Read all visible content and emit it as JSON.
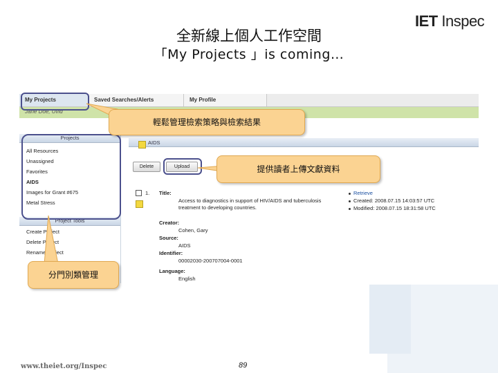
{
  "slide": {
    "title_line1": "全新線上個人工作空間",
    "title_line2": "「My Projects 」is coming…",
    "logo_iet": "IET",
    "logo_inspec": "Inspec",
    "footer_url": "www.theiet.org/Inspec",
    "page_number": "89"
  },
  "tabs": [
    "My Projects",
    "Saved Searches/Alerts",
    "My Profile"
  ],
  "user_name": "Jane Doe, Uvid",
  "projects_panel": {
    "header": "Projects",
    "items": [
      "All Resources",
      "Unassigned",
      "Favorites",
      "AIDS",
      "Images for Grant #675",
      "Metal Stress"
    ],
    "selected": "AIDS"
  },
  "project_tools_panel": {
    "header": "Project Tools",
    "items": [
      "Create Project",
      "Delete Project",
      "Rename Project"
    ]
  },
  "main_panel": {
    "header": "AIDS",
    "delete_label": "Delete",
    "upload_label": "Upload",
    "row_number": "1.",
    "record": {
      "title_label": "Title:",
      "title_value_line1": "Access to diagnostics in support of HIV/AIDS and tuberculosis",
      "title_value_line2": "treatment to developing countries.",
      "creator_label": "Creator:",
      "creator_value": "Cohen, Gary",
      "source_label": "Source:",
      "source_value": "AIDS",
      "identifier_label": "Identifier:",
      "identifier_value": "00002030-200707004-0001",
      "language_label": "Language:",
      "language_value": "English"
    },
    "meta": {
      "retrieve": "Retrieve",
      "created": "Created: 2008.07.15 14:03:57 UTC",
      "modified": "Modified: 2008.07.15 18:31:58 UTC"
    }
  },
  "callouts": {
    "projects": "輕鬆管理檢索策略與檢索結果",
    "upload": "提供讀者上傳文獻資料",
    "folders": "分門別類管理"
  },
  "colors": {
    "callout_fill": "#fbd392",
    "highlight_border": "#4a4f8c",
    "user_bar": "#cfe3a8",
    "panel_header": "#c9d6e6",
    "selected_project": "#000000"
  }
}
